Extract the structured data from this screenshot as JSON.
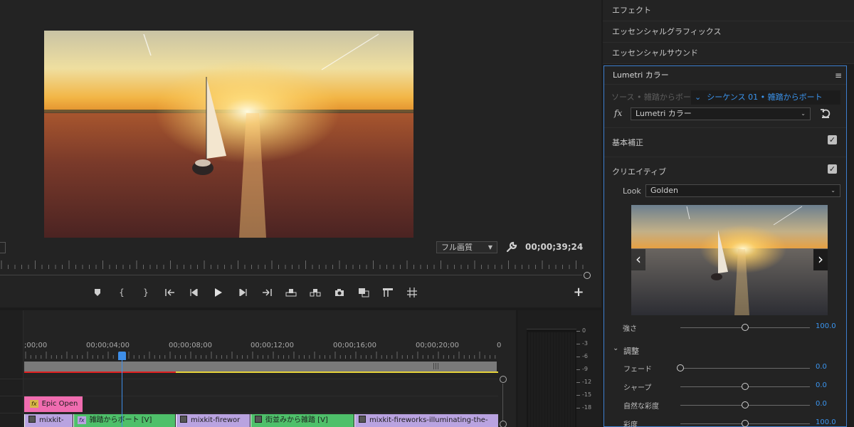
{
  "monitor": {
    "quality": "フル画質",
    "timecode": "00;00;39;24"
  },
  "timeline": {
    "ticks": [
      ";00;00",
      "00;00;04;00",
      "00;00;08;00",
      "00;00;12;00",
      "00;00;16;00",
      "00;00;20;00",
      "0"
    ],
    "clips": {
      "epic": "Epic Open",
      "v1": "mixkit-",
      "v2": "雑踏からボート [V]",
      "v3": "mixkit-firewor",
      "v4": "街並みから雑踏 [V]",
      "v5": "mixkit-fireworks-illuminating-the-"
    },
    "fx_badge": "fx"
  },
  "meter": {
    "labels": [
      "0",
      "-3",
      "-6",
      "-9",
      "-12",
      "-15",
      "-18"
    ]
  },
  "panels": {
    "effects": "エフェクト",
    "essential_graphics": "エッセンシャルグラフィックス",
    "essential_sound": "エッセンシャルサウンド"
  },
  "lumetri": {
    "title": "Lumetri カラー",
    "menu": "≡",
    "source": "ソース • 雑踏からボート",
    "sequence": "シーケンス 01 • 雑踏からボート",
    "fx_label": "fx",
    "effect": "Lumetri カラー",
    "basic": "基本補正",
    "creative": "クリエイティブ",
    "look_label": "Look",
    "look_value": "Golden",
    "intensity_label": "強さ",
    "intensity": "100.0",
    "intensity_level": 0.5,
    "adjust": "調整",
    "sliders": [
      {
        "label": "フェード",
        "value": "0.0",
        "level": 0.0
      },
      {
        "label": "シャープ",
        "value": "0.0",
        "level": 0.5
      },
      {
        "label": "自然な彩度",
        "value": "0.0",
        "level": 0.5
      },
      {
        "label": "彩度",
        "value": "100.0",
        "level": 0.5
      }
    ]
  }
}
